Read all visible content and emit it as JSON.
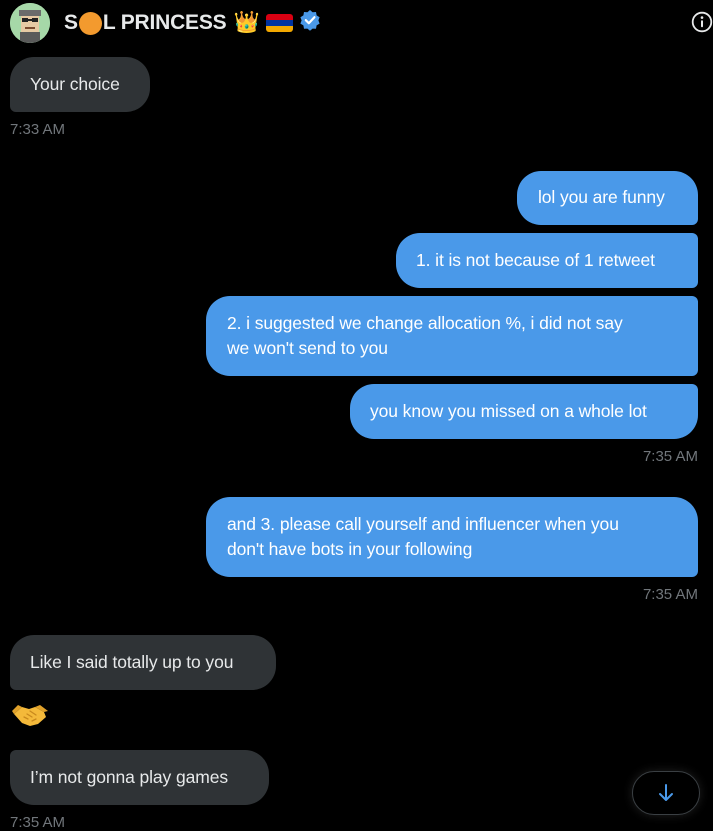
{
  "header": {
    "title_start": "S",
    "title_end": "L PRINCESS",
    "crown_emoji": "👑",
    "flag_name": "armenia-flag",
    "verified_icon": "verified-badge-icon",
    "info_icon": "info-icon"
  },
  "messages": [
    {
      "id": "m1",
      "side": "incoming",
      "text": "Your choice"
    },
    {
      "id": "t1",
      "timestamp": "7:33 AM"
    },
    {
      "id": "m2",
      "side": "outgoing",
      "text": "lol you are funny"
    },
    {
      "id": "m3",
      "side": "outgoing",
      "text": "1. it is not because of 1 retweet"
    },
    {
      "id": "m4",
      "side": "outgoing",
      "line1": "2. i suggested we change allocation %, i did not say",
      "line2": "we won't send to you"
    },
    {
      "id": "m5",
      "side": "outgoing",
      "text": "you know you missed on a whole lot"
    },
    {
      "id": "t2",
      "timestamp": "7:35 AM"
    },
    {
      "id": "m6",
      "side": "outgoing",
      "line1": "and 3. please call yourself and influencer when you",
      "line2": "don't have bots in your following"
    },
    {
      "id": "t3",
      "timestamp": "7:35 AM"
    },
    {
      "id": "m7",
      "side": "incoming",
      "text": "Like I said totally up to you"
    },
    {
      "id": "m8",
      "side": "incoming",
      "emoji": "🤝"
    },
    {
      "id": "m9",
      "side": "incoming",
      "text": "I’m not gonna play games"
    },
    {
      "id": "t4",
      "timestamp": "7:35 AM"
    }
  ],
  "scroll_button": {
    "icon": "arrow-down-icon"
  },
  "colors": {
    "background": "#000000",
    "incoming_bubble": "#2f3336",
    "outgoing_bubble": "#4a99e9",
    "timestamp": "#71767b"
  }
}
